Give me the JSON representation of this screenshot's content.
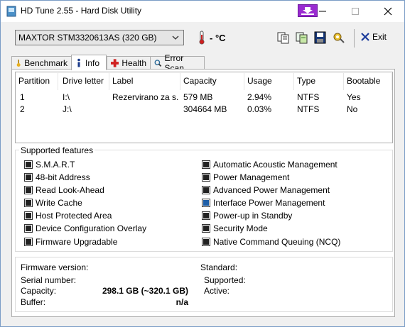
{
  "window": {
    "title": "HD Tune 2.55 - Hard Disk Utility"
  },
  "toolbar": {
    "drive": "MAXTOR STM3320613AS (320 GB)",
    "temperature": "- °C",
    "exit_label": "Exit"
  },
  "tabs": [
    {
      "label": "Benchmark",
      "active": false
    },
    {
      "label": "Info",
      "active": true
    },
    {
      "label": "Health",
      "active": false
    },
    {
      "label": "Error Scan",
      "active": false
    }
  ],
  "partitions": {
    "headers": [
      "Partition",
      "Drive letter",
      "Label",
      "Capacity",
      "Usage",
      "Type",
      "Bootable"
    ],
    "rows": [
      [
        "1",
        "I:\\",
        "Rezervirano za s...",
        "579 MB",
        "2.94%",
        "NTFS",
        "Yes"
      ],
      [
        "2",
        "J:\\",
        "",
        "304664 MB",
        "0.03%",
        "NTFS",
        "No"
      ]
    ]
  },
  "features": {
    "title": "Supported features",
    "left": [
      {
        "label": "S.M.A.R.T",
        "state": "on"
      },
      {
        "label": "48-bit Address",
        "state": "on"
      },
      {
        "label": "Read Look-Ahead",
        "state": "on"
      },
      {
        "label": "Write Cache",
        "state": "on"
      },
      {
        "label": "Host Protected Area",
        "state": "on"
      },
      {
        "label": "Device Configuration Overlay",
        "state": "on"
      },
      {
        "label": "Firmware Upgradable",
        "state": "on"
      }
    ],
    "right": [
      {
        "label": "Automatic Acoustic Management",
        "state": "on"
      },
      {
        "label": "Power Management",
        "state": "on"
      },
      {
        "label": "Advanced Power Management",
        "state": "on"
      },
      {
        "label": "Interface Power Management",
        "state": "partial"
      },
      {
        "label": "Power-up in Standby",
        "state": "on"
      },
      {
        "label": "Security Mode",
        "state": "on"
      },
      {
        "label": "Native Command Queuing (NCQ)",
        "state": "on"
      }
    ]
  },
  "details": {
    "firmware_label": "Firmware version:",
    "firmware_value": "",
    "serial_label": "Serial number:",
    "serial_value": "",
    "capacity_label": "Capacity:",
    "capacity_value": "298.1 GB (~320.1 GB)",
    "buffer_label": "Buffer:",
    "buffer_value": "n/a",
    "standard_label": "Standard:",
    "supported_label": "Supported:",
    "active_label": "Active:"
  },
  "colors": {
    "titlebar_special": "#9a2bd0",
    "partial_check": "#1e5fa8"
  }
}
